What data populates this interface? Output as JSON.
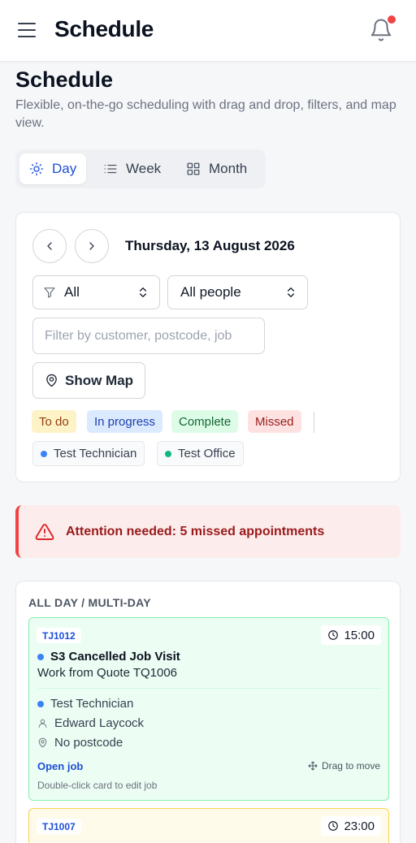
{
  "header": {
    "title": "Schedule",
    "menu_icon": "hamburger-menu-icon",
    "notification_icon": "bell-icon",
    "notification_dot_color": "#ef4444"
  },
  "page": {
    "title": "Schedule",
    "subtitle": "Flexible, on-the-go scheduling with drag and drop, filters, and map view."
  },
  "view_tabs": [
    {
      "label": "Day",
      "icon": "sun-icon",
      "active": true
    },
    {
      "label": "Week",
      "icon": "list-icon",
      "active": false
    },
    {
      "label": "Month",
      "icon": "grid-icon",
      "active": false
    }
  ],
  "filters": {
    "date": "Thursday, 13 August 2026",
    "status_select": "All",
    "people_select": "All people",
    "search_placeholder": "Filter by customer, postcode, job",
    "map_button": "Show Map",
    "status_chips": [
      "To do",
      "In progress",
      "Complete",
      "Missed"
    ],
    "people": [
      {
        "name": "Test Technician",
        "color": "#3b82f6"
      },
      {
        "name": "Test Office",
        "color": "#10b981"
      }
    ]
  },
  "alert": {
    "text": "Attention needed: 5 missed appointments"
  },
  "schedule": {
    "section_title": "ALL DAY / MULTI-DAY",
    "jobs": [
      {
        "ref": "TJ1012",
        "time": "15:00",
        "title": "S3 Cancelled Job Visit",
        "subtitle": "Work from Quote TQ1006",
        "technician": "Test Technician",
        "customer": "Edward Laycock",
        "postcode": "No postcode",
        "open_label": "Open job",
        "drag_label": "Drag to move",
        "hint": "Double-click card to edit job"
      },
      {
        "ref": "TJ1007",
        "time": "23:00"
      }
    ]
  }
}
